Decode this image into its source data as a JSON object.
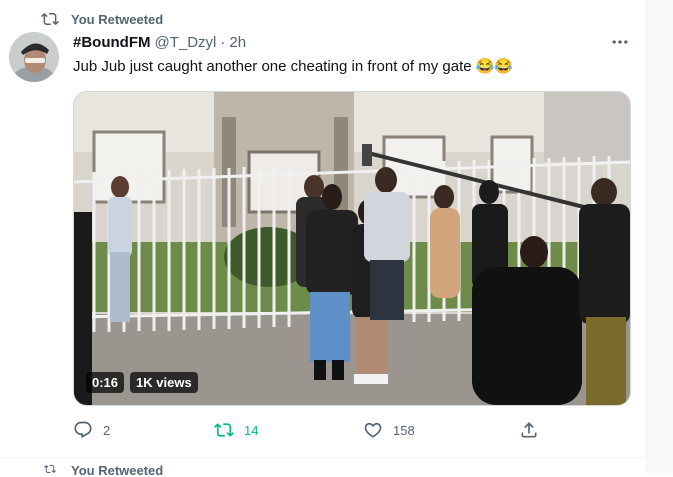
{
  "retweet_context": {
    "label": "You Retweeted"
  },
  "tweet": {
    "display_name": "#BoundFM",
    "handle": "@T_Dzyl",
    "separator": "·",
    "time": "2h",
    "text": "Jub Jub just caught another one cheating in front of my gate 😂😂",
    "video": {
      "duration": "0:16",
      "views": "1K views"
    },
    "actions": {
      "reply_count": "2",
      "retweet_count": "14",
      "like_count": "158"
    }
  },
  "next_tweet": {
    "retweet_label": "You Retweeted"
  },
  "colors": {
    "retweeted_green": "#00ba7c",
    "secondary_text": "#536471",
    "primary_text": "#0f1419"
  },
  "icons": [
    "retweet-icon",
    "more-icon",
    "reply-icon",
    "like-icon",
    "share-icon"
  ]
}
